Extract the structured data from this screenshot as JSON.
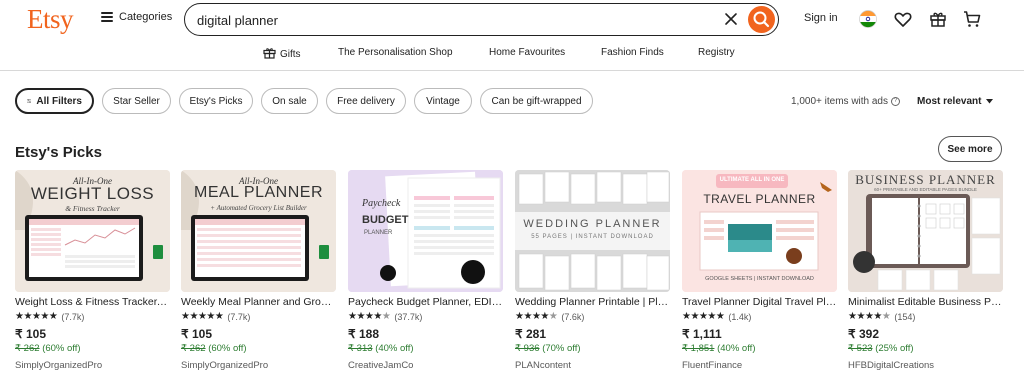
{
  "header": {
    "logo": "Etsy",
    "categories_label": "Categories",
    "search_value": "digital planner",
    "sign_in": "Sign in"
  },
  "nav": {
    "items": [
      "Gifts",
      "The Personalisation Shop",
      "Home Favourites",
      "Fashion Finds",
      "Registry"
    ]
  },
  "filters": {
    "all_filters": "All Filters",
    "chips": [
      "Star Seller",
      "Etsy's Picks",
      "On sale",
      "Free delivery",
      "Vintage",
      "Can be gift-wrapped"
    ],
    "results_count": "1,000+ items with ads",
    "sort_label": "Most relevant"
  },
  "section": {
    "title": "Etsy's Picks",
    "see_more": "See more"
  },
  "products": [
    {
      "title": "Weight Loss & Fitness Tracker, Digital Planner",
      "rating_stars": 5,
      "reviews": "(7.7k)",
      "price": "₹ 105",
      "orig_price": "₹ 262",
      "discount": "(60% off)",
      "shop": "SimplyOrganizedPro",
      "img_lines": [
        "All-In-One",
        "WEIGHT LOSS",
        "& Fitness Tracker"
      ]
    },
    {
      "title": "Weekly Meal Planner and Grocery List",
      "rating_stars": 5,
      "reviews": "(7.7k)",
      "price": "₹ 105",
      "orig_price": "₹ 262",
      "discount": "(60% off)",
      "shop": "SimplyOrganizedPro",
      "img_lines": [
        "All-In-One",
        "MEAL PLANNER",
        "+ Automated Grocery List Builder"
      ]
    },
    {
      "title": "Paycheck Budget Planner, EDITABLE",
      "rating_stars": 4.5,
      "reviews": "(37.7k)",
      "price": "₹ 188",
      "orig_price": "₹ 313",
      "discount": "(40% off)",
      "shop": "CreativeJamCo",
      "img_lines": [
        "Paycheck",
        "BUDGET",
        "PLANNER"
      ]
    },
    {
      "title": "Wedding Planner Printable | Planner",
      "rating_stars": 4.5,
      "reviews": "(7.6k)",
      "price": "₹ 281",
      "orig_price": "₹ 936",
      "discount": "(70% off)",
      "shop": "PLANcontent",
      "img_lines": [
        "WEDDING PLANNER",
        "55 PAGES | INSTANT DOWNLOAD"
      ]
    },
    {
      "title": "Travel Planner Digital Travel Planner",
      "rating_stars": 5,
      "reviews": "(1.4k)",
      "price": "₹ 1,111",
      "orig_price": "₹ 1,851",
      "discount": "(40% off)",
      "shop": "FluentFinance",
      "img_lines": [
        "ULTIMATE ALL IN ONE",
        "TRAVEL PLANNER",
        "GOOGLE SHEETS | INSTANT DOWNLOAD"
      ]
    },
    {
      "title": "Minimalist Editable Business Planner",
      "rating_stars": 4.5,
      "reviews": "(154)",
      "price": "₹ 392",
      "orig_price": "₹ 523",
      "discount": "(25% off)",
      "shop": "HFBDigitalCreations",
      "img_lines": [
        "BUSINESS PLANNER",
        "60+ PRINTABLE AND EDITABLE PAGES BUNDLE"
      ]
    }
  ],
  "colors": {
    "brand": "#F1641E",
    "discount_green": "#2E7D32"
  },
  "icons": [
    "hamburger-icon",
    "clear-icon",
    "search-icon",
    "flag-icon",
    "heart-icon",
    "gift-icon",
    "cart-icon",
    "filter-icon",
    "chevron-down-icon",
    "star-icon"
  ]
}
